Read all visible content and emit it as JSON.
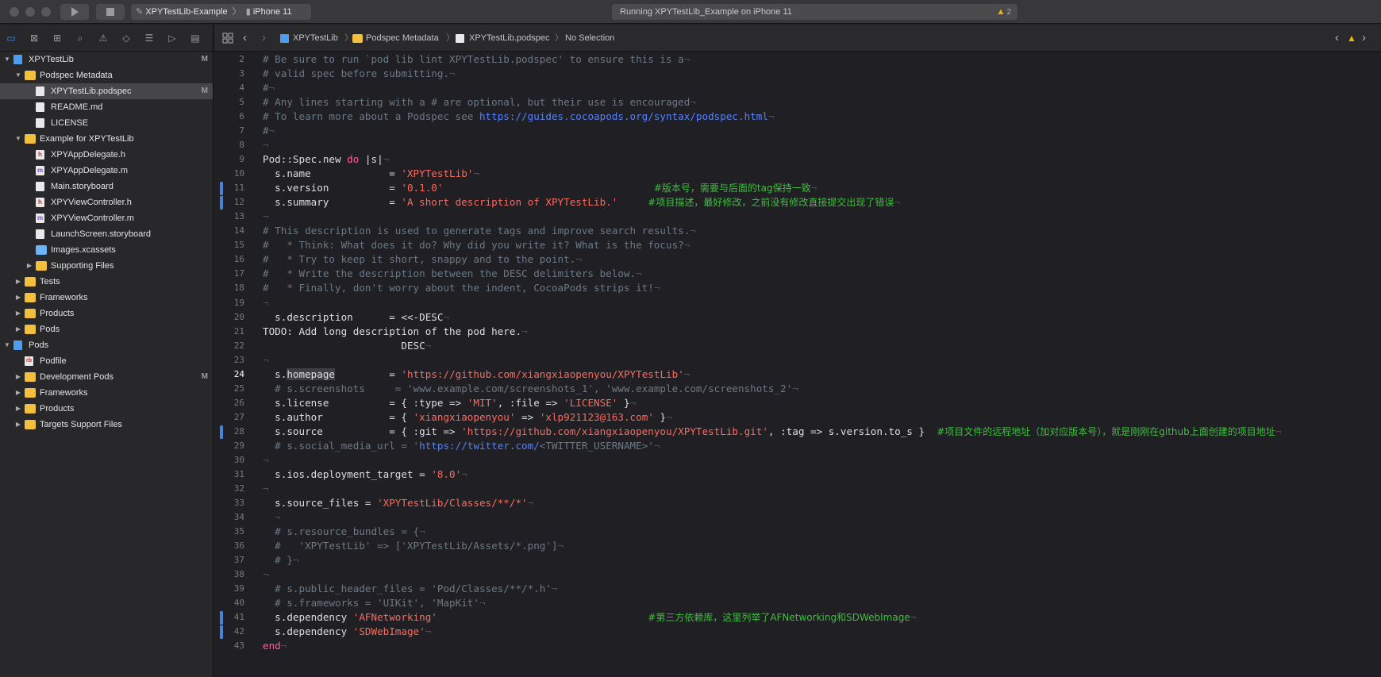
{
  "titlebar": {
    "scheme": "XPYTestLib-Example",
    "device": "iPhone 11",
    "activity": "Running XPYTestLib_Example on iPhone 11",
    "warning_count": "2"
  },
  "navigator": {
    "toolbar_icons": [
      "folder-icon",
      "source-control-icon",
      "hierarchy-icon",
      "find-icon",
      "issue-icon",
      "test-icon",
      "debug-icon",
      "breakpoint-icon",
      "report-icon"
    ],
    "items": [
      {
        "label": "XPYTestLib",
        "badge": "M"
      },
      {
        "label": "Podspec Metadata",
        "badge": ""
      },
      {
        "label": "XPYTestLib.podspec",
        "badge": "M"
      },
      {
        "label": "README.md",
        "badge": ""
      },
      {
        "label": "LICENSE",
        "badge": ""
      },
      {
        "label": "Example for XPYTestLib",
        "badge": ""
      },
      {
        "label": "XPYAppDelegate.h",
        "badge": ""
      },
      {
        "label": "XPYAppDelegate.m",
        "badge": ""
      },
      {
        "label": "Main.storyboard",
        "badge": ""
      },
      {
        "label": "XPYViewController.h",
        "badge": ""
      },
      {
        "label": "XPYViewController.m",
        "badge": ""
      },
      {
        "label": "LaunchScreen.storyboard",
        "badge": ""
      },
      {
        "label": "Images.xcassets",
        "badge": ""
      },
      {
        "label": "Supporting Files",
        "badge": ""
      },
      {
        "label": "Tests",
        "badge": ""
      },
      {
        "label": "Frameworks",
        "badge": ""
      },
      {
        "label": "Products",
        "badge": ""
      },
      {
        "label": "Pods",
        "badge": ""
      },
      {
        "label": "Pods",
        "badge": ""
      },
      {
        "label": "Podfile",
        "badge": ""
      },
      {
        "label": "Development Pods",
        "badge": "M"
      },
      {
        "label": "Frameworks",
        "badge": ""
      },
      {
        "label": "Products",
        "badge": ""
      },
      {
        "label": "Targets Support Files",
        "badge": ""
      }
    ]
  },
  "jumpbar": {
    "crumbs": [
      "XPYTestLib",
      "Podspec Metadata",
      "XPYTestLib.podspec",
      "No Selection"
    ]
  },
  "editor": {
    "current_line": 24,
    "lines": [
      {
        "n": 2,
        "t": [
          [
            "c-cm",
            "# Be sure to run `pod lib lint XPYTestLib.podspec' to ensure this is a"
          ]
        ]
      },
      {
        "n": 3,
        "t": [
          [
            "c-cm",
            "# valid spec before submitting."
          ]
        ]
      },
      {
        "n": 4,
        "t": [
          [
            "c-cm",
            "#"
          ]
        ]
      },
      {
        "n": 5,
        "t": [
          [
            "c-cm",
            "# Any lines starting with a # are optional, but their use is encouraged"
          ]
        ]
      },
      {
        "n": 6,
        "t": [
          [
            "c-cm",
            "# To learn more about a Podspec see "
          ],
          [
            "c-url",
            "https://guides.cocoapods.org/syntax/podspec.html"
          ]
        ]
      },
      {
        "n": 7,
        "t": [
          [
            "c-cm",
            "#"
          ]
        ]
      },
      {
        "n": 8,
        "t": []
      },
      {
        "n": 9,
        "t": [
          [
            "",
            "Pod::Spec.new "
          ],
          [
            "c-kw",
            "do"
          ],
          [
            "",
            " |s|"
          ]
        ]
      },
      {
        "n": 10,
        "t": [
          [
            "",
            "  s.name             = "
          ],
          [
            "c-str",
            "'XPYTestLib'"
          ]
        ]
      },
      {
        "n": 11,
        "t": [
          [
            "",
            "  s.version          = "
          ],
          [
            "c-str",
            "'0.1.0'"
          ],
          [
            "c-inv",
            "                                   "
          ],
          [
            "c-zh",
            "#版本号，需要与后面的tag保持一致"
          ]
        ]
      },
      {
        "n": 12,
        "t": [
          [
            "",
            "  s.summary          = "
          ],
          [
            "c-str",
            "'A short description of XPYTestLib.'"
          ],
          [
            "c-inv",
            "     "
          ],
          [
            "c-zh",
            "#项目描述，最好修改，之前没有修改直接提交出现了错误"
          ]
        ]
      },
      {
        "n": 13,
        "t": []
      },
      {
        "n": 14,
        "t": [
          [
            "c-cm",
            "# This description is used to generate tags and improve search results."
          ]
        ]
      },
      {
        "n": 15,
        "t": [
          [
            "c-cm",
            "#   * Think: What does it do? Why did you write it? What is the focus?"
          ]
        ]
      },
      {
        "n": 16,
        "t": [
          [
            "c-cm",
            "#   * Try to keep it short, snappy and to the point."
          ]
        ]
      },
      {
        "n": 17,
        "t": [
          [
            "c-cm",
            "#   * Write the description between the DESC delimiters below."
          ]
        ]
      },
      {
        "n": 18,
        "t": [
          [
            "c-cm",
            "#   * Finally, don't worry about the indent, CocoaPods strips it!"
          ]
        ]
      },
      {
        "n": 19,
        "t": []
      },
      {
        "n": 20,
        "t": [
          [
            "",
            "  s.description      = <<-DESC"
          ]
        ]
      },
      {
        "n": 21,
        "t": [
          [
            "",
            "TODO: Add long description of the pod here."
          ]
        ]
      },
      {
        "n": 22,
        "t": [
          [
            "",
            "                       DESC"
          ]
        ]
      },
      {
        "n": 23,
        "t": []
      },
      {
        "n": 24,
        "t": [
          [
            "",
            "  s."
          ],
          [
            "c-hl",
            "homepage"
          ],
          [
            "",
            "         = "
          ],
          [
            "c-str",
            "'https://github.com/xiangxiaopenyou/XPYTestLib'"
          ]
        ]
      },
      {
        "n": 25,
        "t": [
          [
            "c-cm",
            "  # s.screenshots     = 'www.example.com/screenshots_1', 'www.example.com/screenshots_2'"
          ]
        ]
      },
      {
        "n": 26,
        "t": [
          [
            "",
            "  s.license          = { :type => "
          ],
          [
            "c-str",
            "'MIT'"
          ],
          [
            "",
            ", :file => "
          ],
          [
            "c-str",
            "'LICENSE'"
          ],
          [
            "",
            " }"
          ]
        ]
      },
      {
        "n": 27,
        "t": [
          [
            "",
            "  s.author           = { "
          ],
          [
            "c-str",
            "'xiangxiaopenyou'"
          ],
          [
            "",
            " => "
          ],
          [
            "c-str",
            "'xlp921123@163.com'"
          ],
          [
            "",
            " }"
          ]
        ]
      },
      {
        "n": 28,
        "t": [
          [
            "",
            "  s.source           = { :git => "
          ],
          [
            "c-str",
            "'https://github.com/xiangxiaopenyou/XPYTestLib.git'"
          ],
          [
            "",
            ", :tag => s.version.to_s }  "
          ],
          [
            "c-zh",
            "#项目文件的远程地址（加对应版本号），就是刚刚在github上面创建的项目地址"
          ]
        ]
      },
      {
        "n": 29,
        "t": [
          [
            "c-cm",
            "  # s.social_media_url = '"
          ],
          [
            "c-url",
            "https://twitter.com/"
          ],
          [
            "c-cm",
            "<TWITTER_USERNAME>'"
          ]
        ]
      },
      {
        "n": 30,
        "t": []
      },
      {
        "n": 31,
        "t": [
          [
            "",
            "  s.ios.deployment_target = "
          ],
          [
            "c-str",
            "'8.0'"
          ]
        ]
      },
      {
        "n": 32,
        "t": []
      },
      {
        "n": 33,
        "t": [
          [
            "",
            "  s.source_files = "
          ],
          [
            "c-str",
            "'XPYTestLib/Classes/**/*'"
          ]
        ]
      },
      {
        "n": 34,
        "t": [
          [
            "c-inv",
            "  "
          ]
        ]
      },
      {
        "n": 35,
        "t": [
          [
            "c-cm",
            "  # s.resource_bundles = {"
          ]
        ]
      },
      {
        "n": 36,
        "t": [
          [
            "c-cm",
            "  #   'XPYTestLib' => ['XPYTestLib/Assets/*.png']"
          ]
        ]
      },
      {
        "n": 37,
        "t": [
          [
            "c-cm",
            "  # }"
          ]
        ]
      },
      {
        "n": 38,
        "t": []
      },
      {
        "n": 39,
        "t": [
          [
            "c-cm",
            "  # s.public_header_files = 'Pod/Classes/**/*.h'"
          ]
        ]
      },
      {
        "n": 40,
        "t": [
          [
            "c-cm",
            "  # s.frameworks = 'UIKit', 'MapKit'"
          ]
        ]
      },
      {
        "n": 41,
        "t": [
          [
            "",
            "  s.dependency "
          ],
          [
            "c-str",
            "'AFNetworking'"
          ],
          [
            "c-inv",
            "                                   "
          ],
          [
            "c-zh",
            "#第三方依赖库，这里列举了AFNetworking和SDWebImage"
          ]
        ]
      },
      {
        "n": 42,
        "t": [
          [
            "",
            "  s.dependency "
          ],
          [
            "c-str",
            "'SDWebImage'"
          ]
        ]
      },
      {
        "n": 43,
        "t": [
          [
            "c-kw",
            "end"
          ]
        ]
      }
    ]
  }
}
